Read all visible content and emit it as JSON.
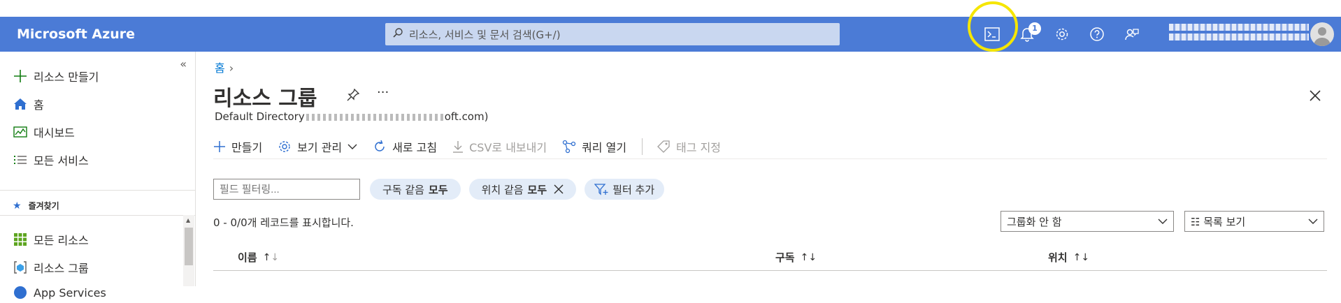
{
  "header": {
    "brand": "Microsoft Azure",
    "search_placeholder": "리소스, 서비스 및 문서 검색(G+/)",
    "notification_count": "1"
  },
  "sidebar": {
    "items_top": [
      {
        "label": "리소스 만들기",
        "icon": "plus-icon"
      },
      {
        "label": "홈",
        "icon": "home-icon"
      },
      {
        "label": "대시보드",
        "icon": "dashboard-icon"
      },
      {
        "label": "모든 서비스",
        "icon": "list-icon"
      }
    ],
    "favorites_header": "즐겨찾기",
    "items_fav": [
      {
        "label": "모든 리소스",
        "icon": "grid-icon"
      },
      {
        "label": "리소스 그룹",
        "icon": "resource-group-icon"
      },
      {
        "label": "App Services",
        "icon": "app-services-icon"
      }
    ]
  },
  "breadcrumb": {
    "home": "홈"
  },
  "page": {
    "title": "리소스 그룹",
    "directory": "Default Directory",
    "directory_suffix": "oft.com)"
  },
  "toolbar": {
    "create": "만들기",
    "manage_view": "보기 관리",
    "refresh": "새로 고침",
    "export_csv": "CSV로 내보내기",
    "open_query": "쿼리 열기",
    "assign_tags": "태그 지정"
  },
  "filters": {
    "field_placeholder": "필드 필터링...",
    "subscription_label": "구독 같음",
    "subscription_value": "모두",
    "location_label": "위치 같음",
    "location_value": "모두",
    "add_filter": "필터 추가"
  },
  "records_text": "0 - 0/0개 레코드를 표시합니다.",
  "grouping": {
    "selected": "그룹화 안 함"
  },
  "view_mode": {
    "selected": "목록 보기"
  },
  "table": {
    "columns": [
      "이름",
      "구독",
      "위치"
    ]
  },
  "colors": {
    "topbar": "#4b7bd6",
    "accent": "#0078d4",
    "highlight": "#f5e600"
  }
}
